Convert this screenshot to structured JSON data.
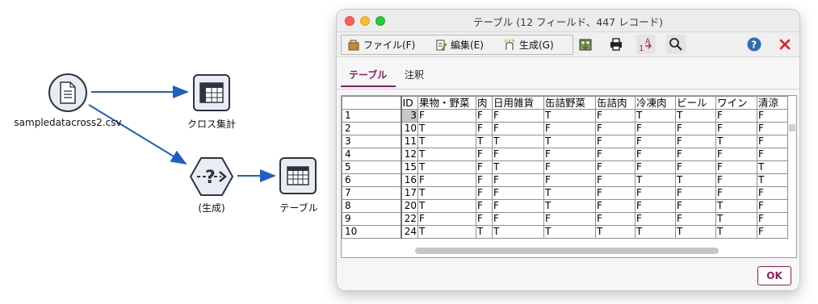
{
  "stream": {
    "csv_node_label": "sampledatacross2.csv",
    "xtab_node_label": "クロス集計",
    "gen_node_label": "(生成)",
    "table_node_label": "テーブル",
    "link_color": "#1f5fc4"
  },
  "dialog": {
    "title": "テーブル (12 フィールド、447 レコード)",
    "menu": {
      "file": "ファイル(F)",
      "edit": "編集(E)",
      "generate": "生成(G)"
    },
    "toolbar_icons": [
      "download-icon",
      "print-icon",
      "sort-icon",
      "search-icon",
      "help-icon",
      "close-red-icon"
    ],
    "tabs": {
      "table": "テーブル",
      "notes": "注釈"
    },
    "columns": [
      "ID",
      "果物・野菜",
      "肉",
      "日用雑貨",
      "缶詰野菜",
      "缶詰肉",
      "冷凍肉",
      "ビール",
      "ワイン",
      "清涼"
    ],
    "rows": [
      {
        "n": "1",
        "cells": [
          "3",
          "F",
          "F",
          "F",
          "T",
          "F",
          "T",
          "T",
          "F",
          "F"
        ]
      },
      {
        "n": "2",
        "cells": [
          "10",
          "T",
          "F",
          "F",
          "F",
          "F",
          "F",
          "F",
          "F",
          "F"
        ]
      },
      {
        "n": "3",
        "cells": [
          "11",
          "T",
          "T",
          "T",
          "T",
          "F",
          "F",
          "F",
          "T",
          "F"
        ]
      },
      {
        "n": "4",
        "cells": [
          "12",
          "T",
          "F",
          "F",
          "F",
          "F",
          "F",
          "F",
          "F",
          "F"
        ]
      },
      {
        "n": "5",
        "cells": [
          "15",
          "T",
          "F",
          "T",
          "F",
          "F",
          "F",
          "F",
          "F",
          "T"
        ]
      },
      {
        "n": "6",
        "cells": [
          "16",
          "F",
          "F",
          "F",
          "F",
          "F",
          "T",
          "T",
          "F",
          "T"
        ]
      },
      {
        "n": "7",
        "cells": [
          "17",
          "T",
          "F",
          "F",
          "T",
          "F",
          "F",
          "F",
          "F",
          "F"
        ]
      },
      {
        "n": "8",
        "cells": [
          "20",
          "T",
          "F",
          "F",
          "T",
          "F",
          "F",
          "F",
          "T",
          "F"
        ]
      },
      {
        "n": "9",
        "cells": [
          "22",
          "F",
          "F",
          "F",
          "F",
          "F",
          "F",
          "F",
          "T",
          "F"
        ]
      },
      {
        "n": "10",
        "cells": [
          "24",
          "T",
          "T",
          "T",
          "T",
          "T",
          "T",
          "T",
          "T",
          "F"
        ]
      }
    ],
    "ok_label": "OK",
    "accent_color": "#8f1d5a"
  }
}
